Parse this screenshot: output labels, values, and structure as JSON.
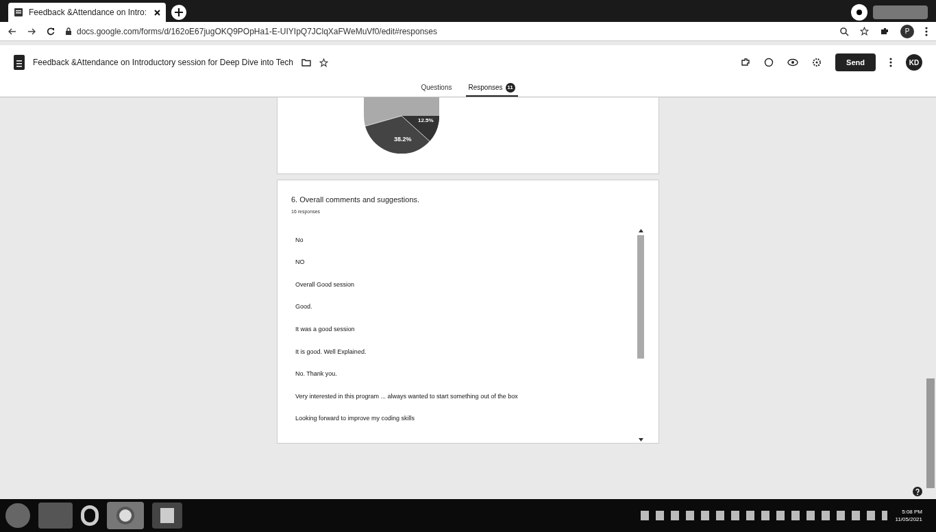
{
  "browser": {
    "tab_title": "Feedback &Attendance on Intro:",
    "url": "docs.google.com/forms/d/162oE67jugOKQ9POpHa1-E-UIYIpQ7JClqXaFWeMuVf0/edit#responses",
    "profile": "P"
  },
  "form": {
    "title": "Feedback &Attendance  on Introductory session for  Deep Dive into Tech",
    "send_label": "Send",
    "avatar": "KD"
  },
  "tabs": [
    {
      "label": "Questions",
      "selected": false
    },
    {
      "label": "Responses",
      "selected": true,
      "badge": "11"
    }
  ],
  "pie_labels": [
    "12.5%",
    "38.2%"
  ],
  "question": {
    "title": "6. Overall comments and suggestions.",
    "count": "16 responses",
    "answers": [
      "No",
      "NO",
      "Overall Good session",
      "Good.",
      "It was a good session",
      "It is good. Well Explained.",
      "No. Thank you.",
      "Very interested in this program   ... always wanted to start something out of the box",
      "Looking forward to improve my coding skills"
    ]
  },
  "clock": {
    "time": "5:08 PM",
    "date": "11/05/2021"
  }
}
